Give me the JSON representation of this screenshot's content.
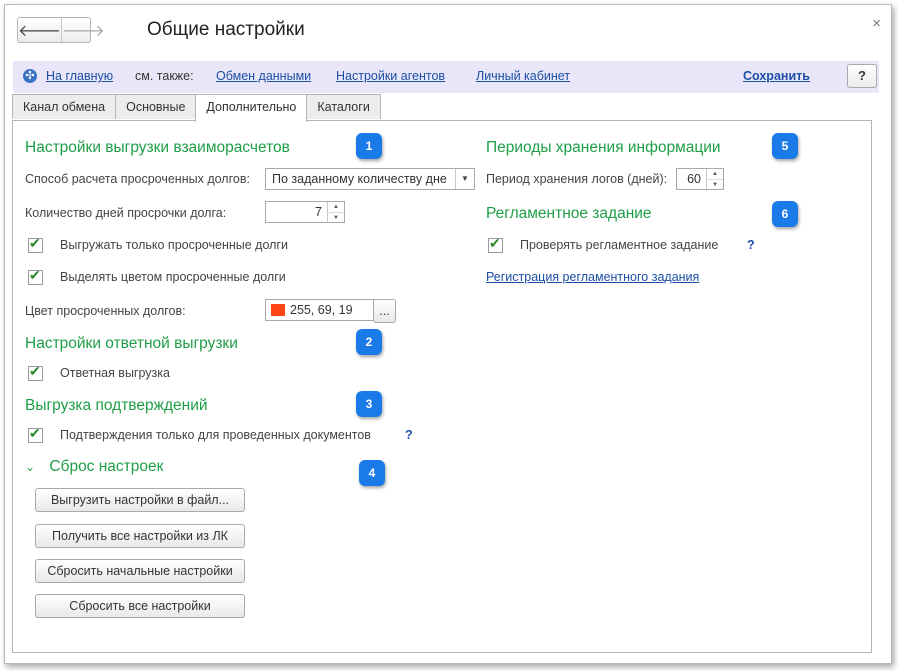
{
  "window": {
    "title": "Общие настройки",
    "back": "🡐",
    "forward": "🡒",
    "close": "×"
  },
  "cmdbar": {
    "home": "На главную",
    "see_also": "см. также:",
    "links": [
      "Обмен данными",
      "Настройки агентов",
      "Личный кабинет"
    ],
    "save": "Сохранить",
    "help": "?"
  },
  "tabs": [
    "Канал обмена",
    "Основные",
    "Дополнительно",
    "Каталоги"
  ],
  "active_tab": "Дополнительно",
  "left": {
    "section1": {
      "title": "Настройки выгрузки взаиморасчетов",
      "badge": "1",
      "method_label": "Способ расчета просроченных долгов:",
      "method_value": "По заданному количеству дне",
      "days_label": "Количество дней просрочки долга:",
      "days_value": "7",
      "cb_only_overdue": "Выгружать только просроченные долги",
      "cb_highlight": "Выделять цветом просроченные долги",
      "color_label": "Цвет просроченных долгов:",
      "color_value": "255, 69, 19",
      "color_hex": "#ff4513",
      "color_btn": "..."
    },
    "section2": {
      "title": "Настройки ответной выгрузки",
      "badge": "2",
      "cb_response": "Ответная выгрузка"
    },
    "section3": {
      "title": "Выгрузка подтверждений",
      "badge": "3",
      "cb_confirm": "Подтверждения только для проведенных документов",
      "help": "?"
    },
    "section4": {
      "title": "Сброс настроек",
      "badge": "4",
      "buttons": [
        "Выгрузить настройки в файл...",
        "Получить все настройки из ЛК",
        "Сбросить начальные настройки",
        "Сбросить все настройки"
      ]
    }
  },
  "right": {
    "section5": {
      "title": "Периоды хранения информации",
      "badge": "5",
      "period_label": "Период хранения логов (дней):",
      "period_value": "60"
    },
    "section6": {
      "title": "Регламентное задание",
      "badge": "6",
      "cb_check": "Проверять регламентное задание",
      "help": "?",
      "link": "Регистрация регламентного задания"
    }
  },
  "colors": {
    "accent_green": "#1e9e47",
    "badge_blue": "#1a7be8",
    "link_blue": "#1d4fa6",
    "cmdbar_bg": "#e8e6f8"
  }
}
